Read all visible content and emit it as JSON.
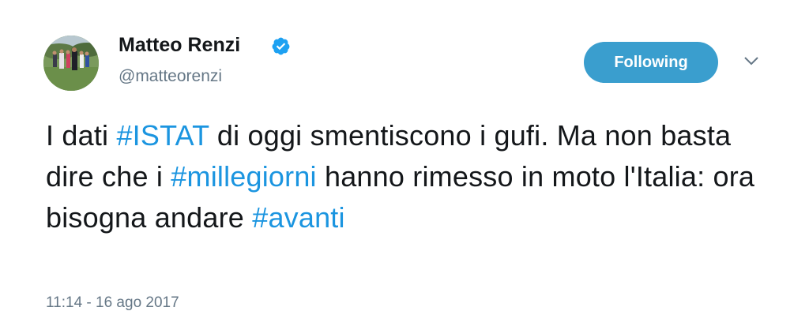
{
  "author": {
    "name": "Matteo Renzi",
    "handle": "@matteorenzi",
    "verified_icon": "verified-badge-icon",
    "avatar_icon": "profile-photo"
  },
  "actions": {
    "follow_label": "Following",
    "menu_icon": "chevron-down-icon"
  },
  "tweet": {
    "segments": [
      {
        "text": "I dati ",
        "type": "text"
      },
      {
        "text": "#ISTAT",
        "type": "hashtag"
      },
      {
        "text": " di oggi smentiscono i gufi. Ma non basta dire che i ",
        "type": "text"
      },
      {
        "text": "#millegiorni",
        "type": "hashtag"
      },
      {
        "text": " hanno rimesso in moto l'Italia: ora bisogna andare ",
        "type": "text"
      },
      {
        "text": "#avanti",
        "type": "hashtag"
      }
    ],
    "timestamp": "11:14 - 16 ago 2017"
  },
  "colors": {
    "link": "#1b95e0",
    "button": "#3a9ece",
    "secondary_text": "#657786",
    "primary_text": "#14171a"
  }
}
